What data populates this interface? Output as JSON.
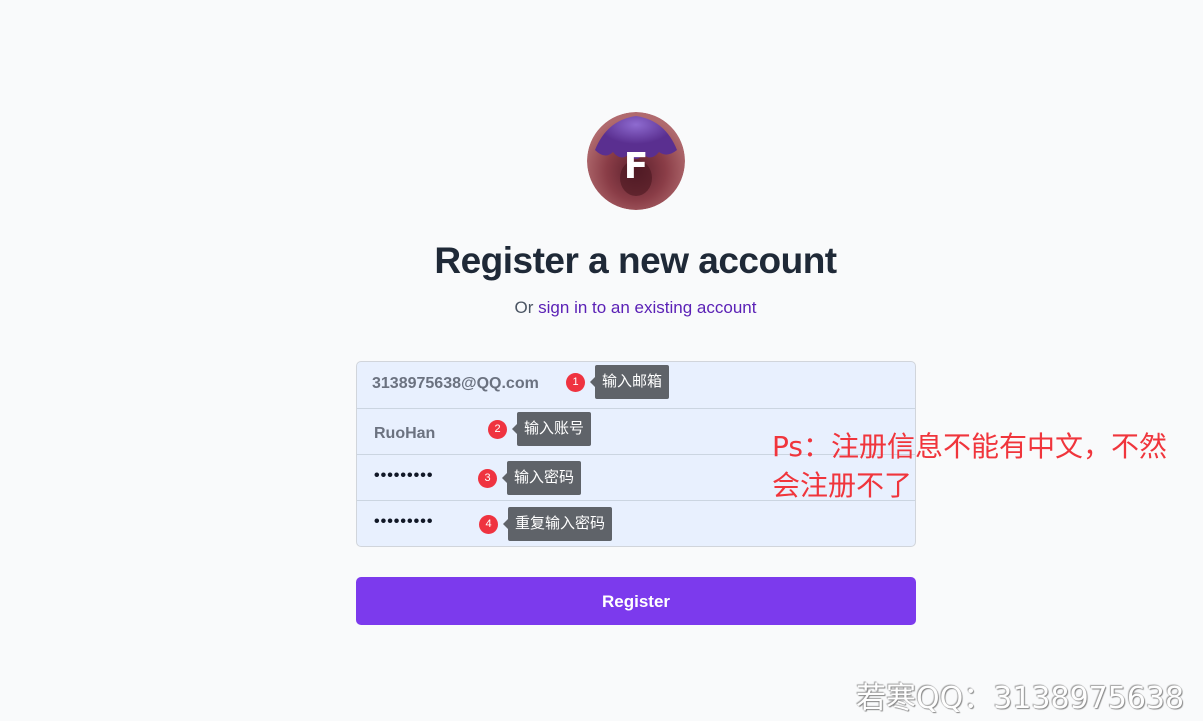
{
  "logo": {
    "letter": "F",
    "colors": {
      "ring": "#a0525b",
      "center": "#7a2f3a",
      "glow": "#6b3fa0",
      "letter": "#ffffff"
    }
  },
  "heading": {
    "title": "Register a new account",
    "subtitle_prefix": "Or",
    "signin_link": "sign in to an existing account"
  },
  "form": {
    "email": {
      "value": "3138975638@QQ.com",
      "badge": "1",
      "tip": "输入邮箱"
    },
    "username": {
      "value": "RuoHan",
      "badge": "2",
      "tip": "输入账号"
    },
    "password": {
      "value": "•••••••••",
      "badge": "3",
      "tip": "输入密码"
    },
    "confirm_password": {
      "value": "•••••••••",
      "badge": "4",
      "tip": "重复输入密码"
    }
  },
  "register_button": "Register",
  "annotation": {
    "line1": "Ps：注册信息不能有中文，不然",
    "line2": "会注册不了"
  },
  "watermark": "若寒QQ：3138975638",
  "colors": {
    "accent": "#7c3aed",
    "link": "#5b21b6",
    "badge": "#ef3340",
    "note": "#f0353c",
    "background": "#f9fafb",
    "autofill": "#e8f0fe"
  }
}
